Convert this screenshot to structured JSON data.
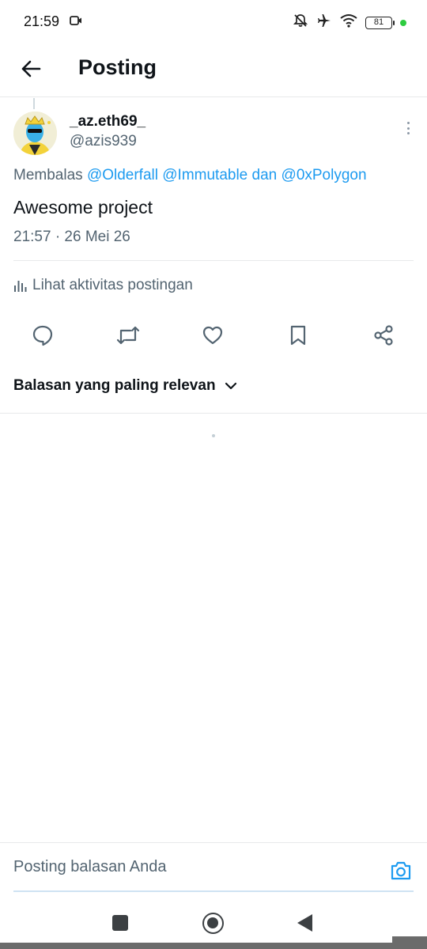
{
  "status_bar": {
    "time": "21:59",
    "battery": "81",
    "icons": [
      "video-record-icon",
      "bell-off-icon",
      "airplane-icon",
      "wifi-icon",
      "battery-icon"
    ],
    "dot_color": "#2ecc40"
  },
  "header": {
    "title": "Posting",
    "back_icon": "arrow-left-icon"
  },
  "post": {
    "display_name": "_az.eth69_",
    "handle": "@azis939",
    "reply_prefix": "Membalas",
    "mentions": [
      "@Olderfall",
      "@Immutable",
      "@0xPolygon"
    ],
    "connector": "dan",
    "text": "Awesome project",
    "timestamp": "21:57 · 26 Mei 26",
    "activity_label": "Lihat aktivitas postingan"
  },
  "actions": [
    "reply-icon",
    "repost-icon",
    "like-icon",
    "bookmark-icon",
    "share-icon"
  ],
  "replies": {
    "sort_label": "Balasan yang paling relevan"
  },
  "composer": {
    "placeholder": "Posting balasan Anda"
  },
  "colors": {
    "accent": "#1d9bf0",
    "text_primary": "#0f1419",
    "text_secondary": "#536471"
  }
}
